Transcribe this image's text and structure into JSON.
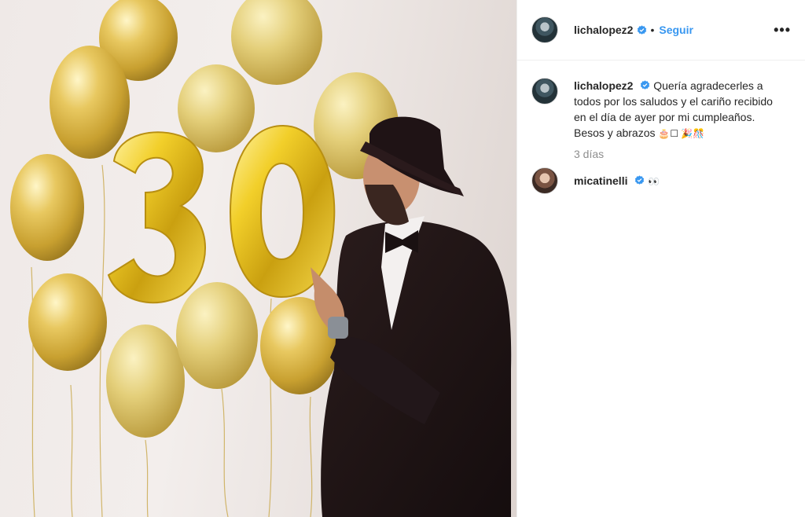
{
  "post": {
    "username": "lichalopez2",
    "follow_label": "Seguir",
    "separator": "•",
    "more_label": "•••",
    "caption": {
      "text": "Quería agradecerles a todos por los saludos y el cariño recibido en el día de ayer por mi cumpleaños. Besos y abrazos",
      "emojis": "🎂☐ 🎉🎊"
    },
    "time_ago": "3 días",
    "comments": [
      {
        "username": "micatinelli",
        "emoji": "👀"
      }
    ],
    "photo": {
      "balloon_number": "30"
    },
    "colors": {
      "accent": "#3897f0",
      "verified": "#3897f0",
      "muted": "#8e8e8e"
    }
  }
}
